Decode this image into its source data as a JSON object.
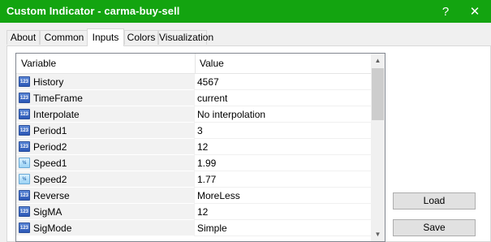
{
  "window": {
    "title": "Custom Indicator - carma-buy-sell",
    "help_glyph": "?",
    "close_glyph": "✕"
  },
  "tabs": [
    {
      "label": "About"
    },
    {
      "label": "Common"
    },
    {
      "label": "Inputs",
      "active": true
    },
    {
      "label": "Colors"
    },
    {
      "label": "Visualization"
    }
  ],
  "table": {
    "columns": [
      "Variable",
      "Value"
    ],
    "rows": [
      {
        "icon": "int-type-icon",
        "icon_text": "123",
        "name": "History",
        "value": "4567"
      },
      {
        "icon": "int-type-icon",
        "icon_text": "123",
        "name": "TimeFrame",
        "value": "current"
      },
      {
        "icon": "int-type-icon",
        "icon_text": "123",
        "name": "Interpolate",
        "value": "No interpolation"
      },
      {
        "icon": "int-type-icon",
        "icon_text": "123",
        "name": "Period1",
        "value": "3"
      },
      {
        "icon": "int-type-icon",
        "icon_text": "123",
        "name": "Period2",
        "value": "12"
      },
      {
        "icon": "double-type-icon",
        "icon_text": "½",
        "name": "Speed1",
        "value": "1.99"
      },
      {
        "icon": "double-type-icon",
        "icon_text": "½",
        "name": "Speed2",
        "value": "1.77"
      },
      {
        "icon": "int-type-icon",
        "icon_text": "123",
        "name": "Reverse",
        "value": "MoreLess"
      },
      {
        "icon": "int-type-icon",
        "icon_text": "123",
        "name": "SigMA",
        "value": "12"
      },
      {
        "icon": "int-type-icon",
        "icon_text": "123",
        "name": "SigMode",
        "value": "Simple"
      }
    ]
  },
  "buttons": {
    "load": "Load",
    "save": "Save"
  },
  "colors": {
    "titlebar": "#13a410",
    "row_name_bg": "#f2f2f2"
  }
}
